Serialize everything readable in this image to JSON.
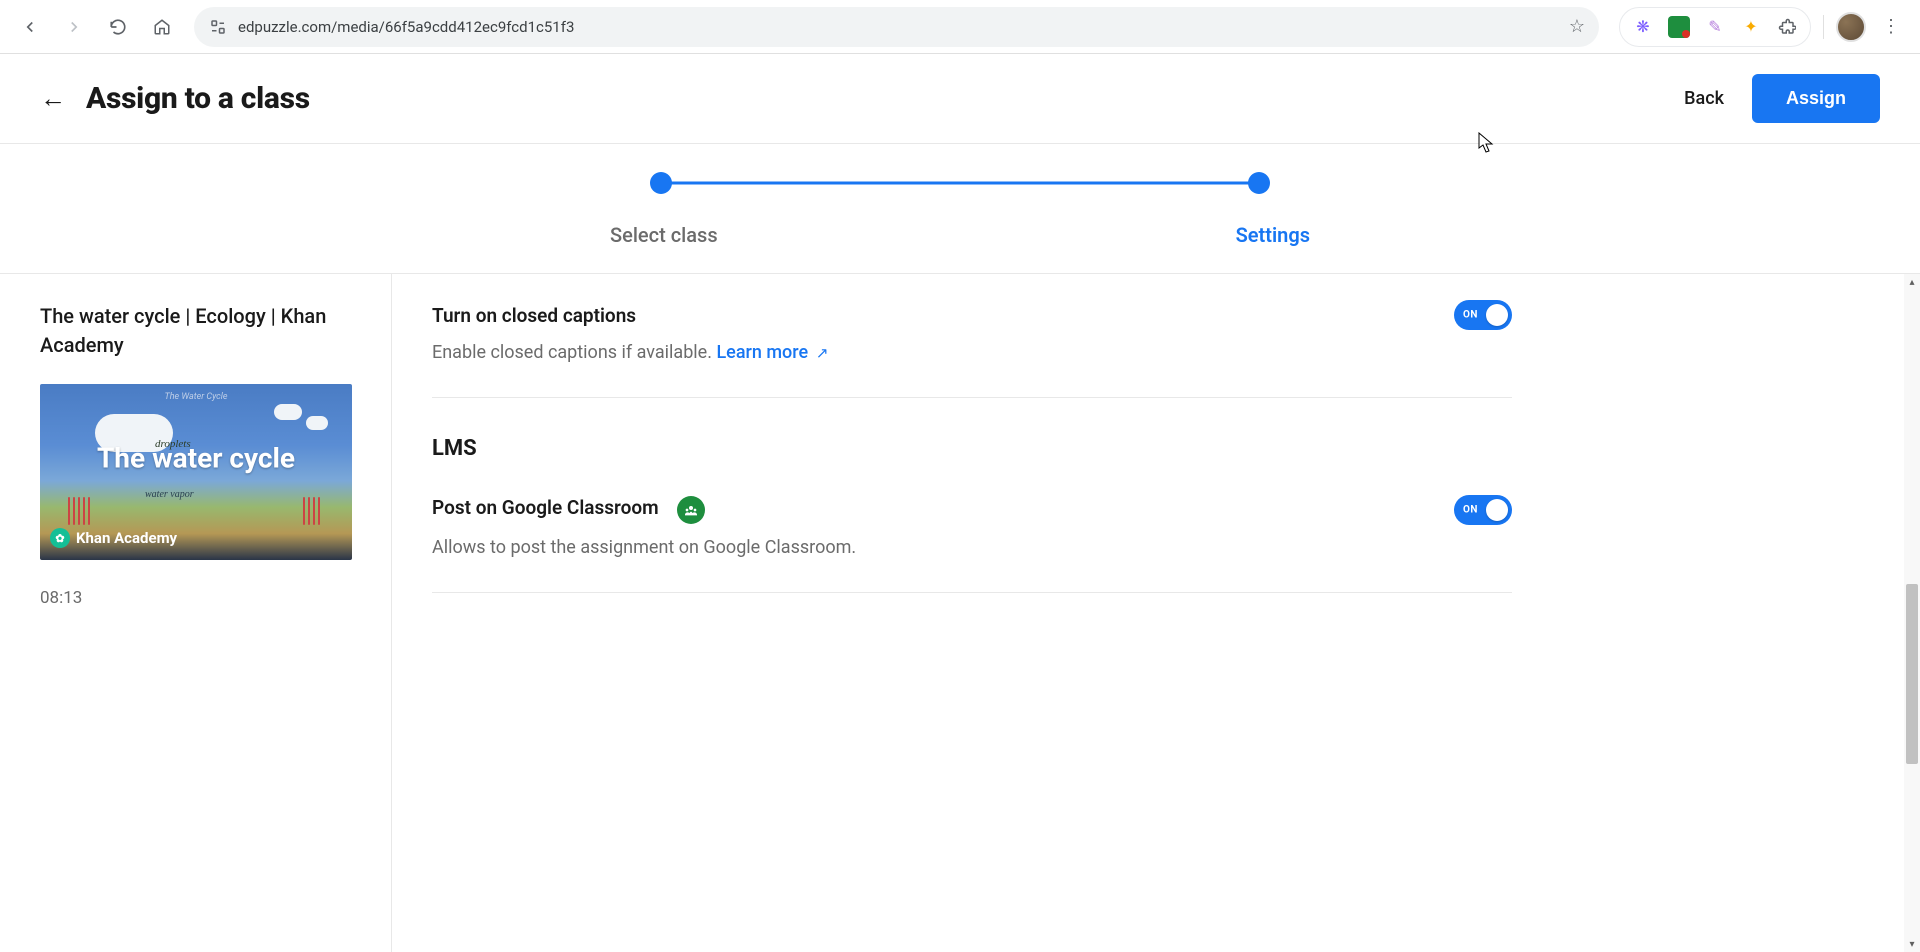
{
  "browser": {
    "url": "edpuzzle.com/media/66f5a9cdd412ec9fcd1c51f3"
  },
  "header": {
    "title": "Assign to a class",
    "back_label": "Back",
    "assign_label": "Assign"
  },
  "stepper": {
    "step1": "Select class",
    "step2": "Settings"
  },
  "video": {
    "title": "The water cycle | Ecology | Khan Academy",
    "duration": "08:13",
    "thumb_title": "The Water Cycle",
    "thumb_main": "The water cycle",
    "thumb_droplets": "droplets",
    "thumb_vapor": "water vapor",
    "thumb_brand": "Khan Academy"
  },
  "settings": {
    "cc": {
      "title": "Turn on closed captions",
      "subtitle": "Enable closed captions if available. ",
      "learn_more": "Learn more",
      "toggle": "ON"
    },
    "lms_heading": "LMS",
    "gc": {
      "title": "Post on Google Classroom",
      "subtitle": "Allows to post the assignment on Google Classroom.",
      "toggle": "ON"
    }
  }
}
